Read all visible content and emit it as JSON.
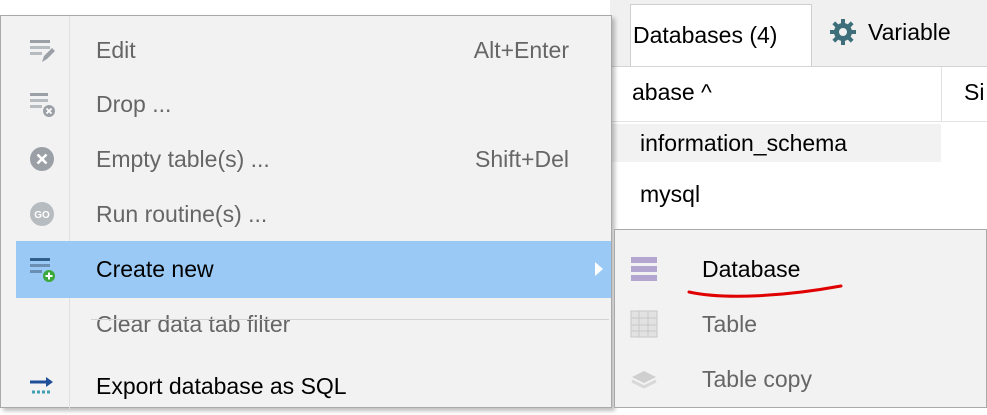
{
  "background": {
    "tabs": [
      {
        "label": "Databases (4)"
      },
      {
        "label": "Variable"
      }
    ],
    "columns": [
      {
        "label": "abase ^"
      },
      {
        "label": "Si"
      }
    ],
    "rows": [
      {
        "name": "information_schema"
      },
      {
        "name": "mysql"
      }
    ]
  },
  "context_menu": {
    "items": [
      {
        "label": "Edit",
        "shortcut": "Alt+Enter",
        "icon": "edit-icon"
      },
      {
        "label": "Drop ...",
        "shortcut": "",
        "icon": "drop-icon"
      },
      {
        "label": "Empty table(s) ...",
        "shortcut": "Shift+Del",
        "icon": "empty-table-icon"
      },
      {
        "label": "Run routine(s) ...",
        "shortcut": "",
        "icon": "run-routine-icon"
      },
      {
        "label": "Create new",
        "shortcut": "",
        "icon": "create-new-icon",
        "highlighted": true
      },
      {
        "label": "Clear data tab filter",
        "shortcut": "",
        "icon": ""
      },
      {
        "label": "Export database as SQL",
        "shortcut": "",
        "icon": "export-icon"
      }
    ],
    "highlight_color": "#99c9f4"
  },
  "submenu": {
    "items": [
      {
        "label": "Database",
        "icon": "database-icon"
      },
      {
        "label": "Table",
        "icon": "table-icon"
      },
      {
        "label": "Table copy",
        "icon": "table-copy-icon"
      }
    ]
  },
  "annotation": {
    "color": "#e00000"
  }
}
